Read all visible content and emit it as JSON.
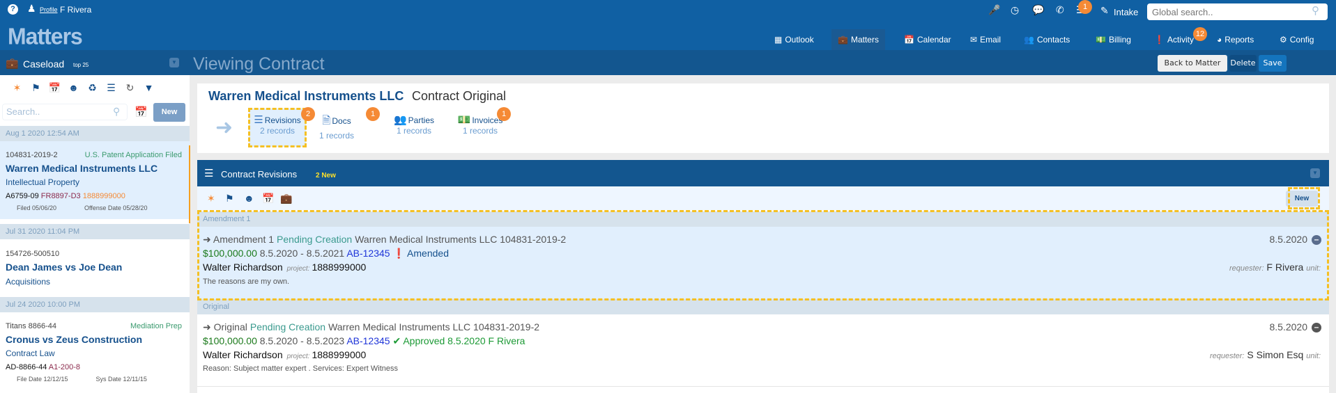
{
  "topbar": {
    "help_icon": "question-circle-icon",
    "user_icon": "user-secret-icon",
    "profile_label": "Profile",
    "username": "F Rivera",
    "brand": "Matters",
    "quick_icons": [
      "microphone-icon",
      "clock-icon",
      "chat-icon",
      "phone-icon",
      "list-icon"
    ],
    "list_badge": "1",
    "intake_label": "Intake",
    "search_placeholder": "Global search.."
  },
  "nav": {
    "items": [
      {
        "label": "Outlook",
        "icon": "grid-icon"
      },
      {
        "label": "Matters",
        "icon": "briefcase-icon",
        "active": true
      },
      {
        "label": "Calendar",
        "icon": "calendar-icon"
      },
      {
        "label": "Email",
        "icon": "envelope-icon"
      },
      {
        "label": "Contacts",
        "icon": "users-icon"
      },
      {
        "label": "Billing",
        "icon": "money-icon"
      },
      {
        "label": "Activity",
        "icon": "exclamation-icon",
        "badge": "12"
      },
      {
        "label": "Reports",
        "icon": "pie-chart-icon"
      },
      {
        "label": "Config",
        "icon": "cogs-icon"
      }
    ]
  },
  "subbar": {
    "caseload_label": "Caseload",
    "caseload_top": "top 25",
    "page_title": "Viewing Contract",
    "back_label": "Back to Matter",
    "delete_label": "Delete",
    "save_label": "Save"
  },
  "sidebar": {
    "search_placeholder": "Search..",
    "new_label": "New",
    "groups": [
      {
        "date": "Aug 1 2020 12:54 AM",
        "case": {
          "number": "104831-2019-2",
          "status": "U.S. Patent Application Filed",
          "title": "Warren Medical Instruments LLC",
          "area": "Intellectual Property",
          "ref1": "A6759-09",
          "ref2": "FR8897-D3",
          "ref3": "1888999000",
          "date1": "Filed 05/06/20",
          "date2": "Offense Date 05/28/20"
        }
      },
      {
        "date": "Jul 31 2020 11:04 PM",
        "case": {
          "number": "154726-500510",
          "title": "Dean James vs Joe Dean",
          "area": "Acquisitions"
        }
      },
      {
        "date": "Jul 24 2020 10:00 PM",
        "case": {
          "number": "Titans 8866-44",
          "status": "Mediation Prep",
          "title": "Cronus vs Zeus Construction",
          "area": "Contract Law",
          "ref1": "AD-8866-44",
          "ref2": "A1-200-8",
          "date1": "File Date 12/12/15",
          "date2": "Sys Date 12/11/15"
        }
      }
    ]
  },
  "contract": {
    "client": "Warren Medical Instruments LLC",
    "type": "Contract Original",
    "tabs": [
      {
        "label": "Revisions",
        "count": "2 records",
        "badge": "2",
        "icon": "list-icon"
      },
      {
        "label": "Docs",
        "count": "1 records",
        "badge": "1",
        "icon": "pdf-file-icon"
      },
      {
        "label": "Parties",
        "count": "1 records",
        "icon": "users-icon"
      },
      {
        "label": "Invoices",
        "count": "1 records",
        "badge": "1",
        "icon": "money-icon"
      }
    ]
  },
  "panel": {
    "title": "Contract Revisions",
    "new_count": "2 New",
    "new_label": "New",
    "revisions": [
      {
        "group": "Amendment 1",
        "name": "Amendment 1",
        "status": "Pending Creation",
        "matter": "Warren Medical Instruments LLC 104831-2019-2",
        "amount": "$100,000.00",
        "period": "8.5.2020 - 8.5.2021",
        "ref": "AB-12345",
        "state": "Amended",
        "person": "Walter Richardson",
        "project_label": "project:",
        "project": "1888999000",
        "note": "The reasons are my own.",
        "date": "8.5.2020",
        "requester_label": "requester:",
        "requester": "F Rivera",
        "unit_label": "unit:"
      },
      {
        "group": "Original",
        "name": "Original",
        "status": "Pending Creation",
        "matter": "Warren Medical Instruments LLC 104831-2019-2",
        "amount": "$100,000.00",
        "period": "8.5.2020 - 8.5.2023",
        "ref": "AB-12345",
        "state": "Approved 8.5.2020 F Rivera",
        "person": "Walter Richardson",
        "project_label": "project:",
        "project": "1888999000",
        "note": "Reason: Subject matter expert . Services: Expert Witness",
        "date": "8.5.2020",
        "requester_label": "requester:",
        "requester": "S Simon Esq",
        "unit_label": "unit:"
      }
    ]
  }
}
